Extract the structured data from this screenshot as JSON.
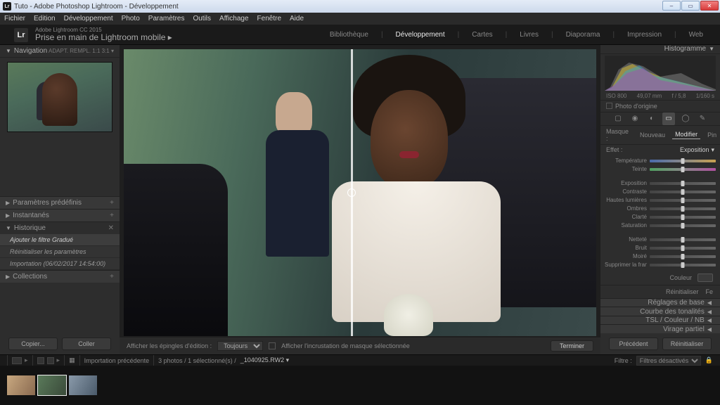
{
  "titlebar": {
    "text": "Tuto - Adobe Photoshop Lightroom - Développement"
  },
  "menubar": [
    "Fichier",
    "Edition",
    "Développement",
    "Photo",
    "Paramètres",
    "Outils",
    "Affichage",
    "Fenêtre",
    "Aide"
  ],
  "identity": {
    "version": "Adobe Lightroom CC 2015",
    "doc": "Prise en main de Lightroom mobile  ▸"
  },
  "modules": {
    "items": [
      "Bibliothèque",
      "Développement",
      "Cartes",
      "Livres",
      "Diaporama",
      "Impression",
      "Web"
    ],
    "active_index": 1
  },
  "left": {
    "navigation": {
      "label": "Navigation",
      "opts": "ADAPT.   REMPL.   1:1   3:1  ▾"
    },
    "presets": "Paramètres prédéfinis",
    "snapshots": "Instantanés",
    "history": {
      "label": "Historique",
      "items": [
        "Ajouter le filtre Gradué",
        "Réinitialiser les paramètres",
        "Importation (06/02/2017 14:54:00)"
      ],
      "active_index": 0
    },
    "collections": "Collections",
    "btn_copy": "Copier...",
    "btn_paste": "Coller"
  },
  "center": {
    "pins_label": "Afficher les épingles d'édition :",
    "pins_value": "Toujours",
    "mask_overlay": "Afficher l'incrustation de masque sélectionnée",
    "done": "Terminer"
  },
  "right": {
    "histogram_label": "Histogramme",
    "histo_info": {
      "iso": "ISO 800",
      "focal": "49,07 mm",
      "aperture": "f / 5,8",
      "shutter": "1/160 s"
    },
    "original": "Photo d'origine",
    "mask": {
      "label": "Masque :",
      "new": "Nouveau",
      "edit": "Modifier",
      "pin": "Pin"
    },
    "effect": {
      "label": "Effet :",
      "value": "Exposition"
    },
    "slider_groups": [
      [
        "Température",
        "Teinte"
      ],
      [
        "Exposition",
        "Contraste",
        "Hautes lumières",
        "Ombres",
        "Clarté",
        "Saturation"
      ],
      [
        "Netteté",
        "Bruit",
        "Moiré",
        "Supprimer la frange"
      ]
    ],
    "color_label": "Couleur",
    "reset": "Réinitialiser",
    "close": "Fe",
    "panels": [
      "Réglages de base",
      "Courbe des tonalités",
      "TSL / Couleur / NB",
      "Virage partiel"
    ],
    "btn_prev": "Précédent",
    "btn_reset": "Réinitialiser"
  },
  "filmstrip_info": {
    "source": "Importation précédente",
    "counts": "3 photos / 1 sélectionné(s) /",
    "filename": "_1040925.RW2  ▾",
    "filter_label": "Filtre :",
    "filter_value": "Filtres désactivés"
  }
}
